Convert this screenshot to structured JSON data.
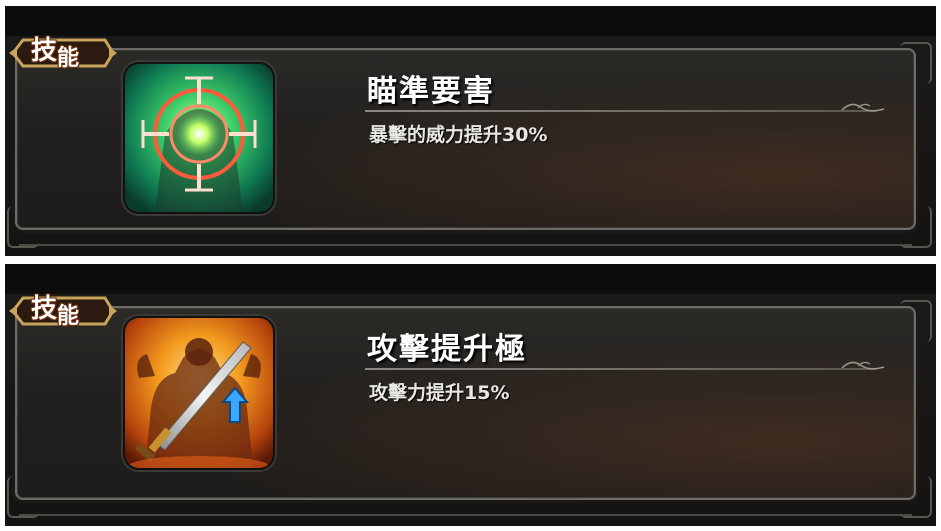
{
  "skills": [
    {
      "badge_char1": "技",
      "badge_char2": "能",
      "name": "瞄準要害",
      "description": "暴擊的威力提升30%",
      "icon": "crosshair-target-icon",
      "accent": "#39d06a"
    },
    {
      "badge_char1": "技",
      "badge_char2": "能",
      "name": "攻擊提升極",
      "description": "攻擊力提升15%",
      "icon": "sword-attack-up-icon",
      "accent": "#f29a1e"
    }
  ],
  "colors": {
    "panel_bg": "#1c1b1a",
    "frame_border": "#6e6b66",
    "badge_gold": "#c9a45a",
    "text_primary": "#ffffff"
  }
}
